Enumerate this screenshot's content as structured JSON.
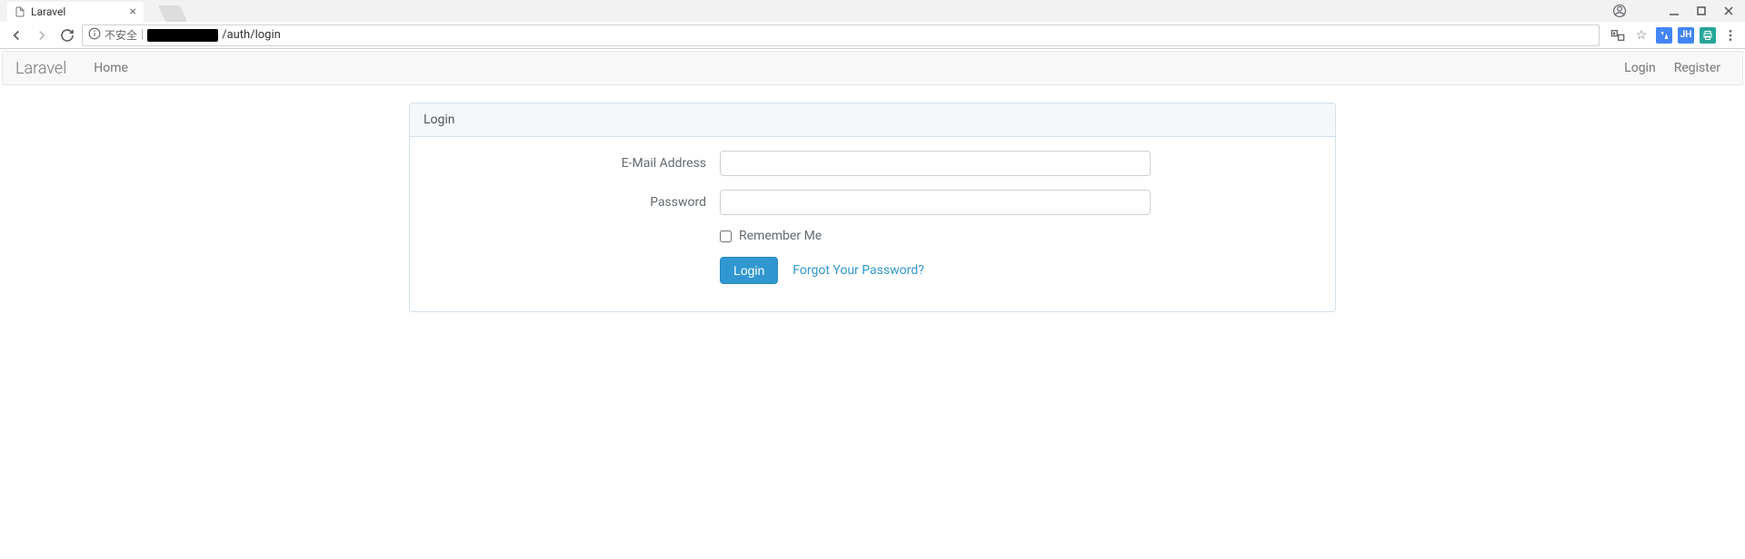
{
  "browser": {
    "tab_title": "Laravel",
    "url_security_label": "不安全",
    "url_path": "/auth/login"
  },
  "navbar": {
    "brand": "Laravel",
    "home": "Home",
    "login": "Login",
    "register": "Register"
  },
  "panel": {
    "heading": "Login"
  },
  "form": {
    "email_label": "E-Mail Address",
    "email_value": "",
    "password_label": "Password",
    "password_value": "",
    "remember_label": "Remember Me",
    "login_button": "Login",
    "forgot_link": "Forgot Your Password?"
  }
}
